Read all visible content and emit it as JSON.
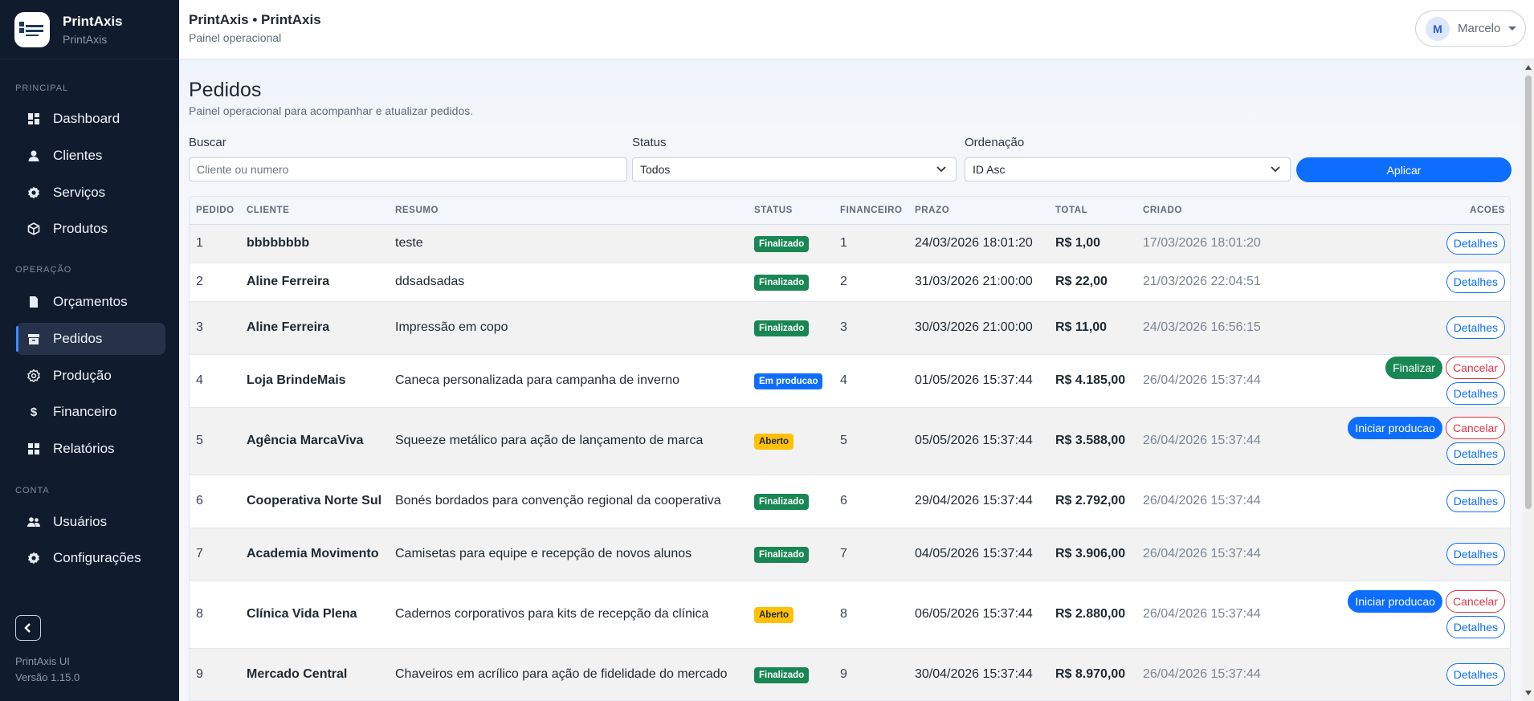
{
  "brand": {
    "name": "PrintAxis",
    "sub": "PrintAxis"
  },
  "nav": {
    "sections": {
      "principal": "PRINCIPAL",
      "operacao": "OPERAÇÃO",
      "conta": "CONTA"
    },
    "items": {
      "dashboard": "Dashboard",
      "clientes": "Clientes",
      "servicos": "Serviços",
      "produtos": "Produtos",
      "orcamentos": "Orçamentos",
      "pedidos": "Pedidos",
      "producao": "Produção",
      "financeiro": "Financeiro",
      "relatorios": "Relatórios",
      "usuarios": "Usuários",
      "configuracoes": "Configurações"
    },
    "active": "pedidos"
  },
  "sidebar_footer": {
    "app": "PrintAxis UI",
    "version": "Versão 1.15.0"
  },
  "header": {
    "title": "PrintAxis • PrintAxis",
    "subtitle": "Painel operacional",
    "user_initial": "M",
    "user_name": "Marcelo"
  },
  "page": {
    "title": "Pedidos",
    "subtitle": "Painel operacional para acompanhar e atualizar pedidos."
  },
  "filters": {
    "search_label": "Buscar",
    "search_placeholder": "Cliente ou numero",
    "status_label": "Status",
    "status_value": "Todos",
    "order_label": "Ordenação",
    "order_value": "ID Asc",
    "apply_label": "Aplicar"
  },
  "table": {
    "headers": {
      "pedido": "PEDIDO",
      "cliente": "CLIENTE",
      "resumo": "RESUMO",
      "status": "STATUS",
      "financeiro": "FINANCEIRO",
      "prazo": "PRAZO",
      "total": "TOTAL",
      "criado": "CRIADO",
      "acoes": "ACOES"
    },
    "action_labels": {
      "detalhes": "Detalhes",
      "finalizar": "Finalizar",
      "cancelar": "Cancelar",
      "iniciar": "Iniciar producao"
    },
    "rows": [
      {
        "id": "1",
        "cliente": "bbbbbbbb",
        "resumo": "teste",
        "status": "Finalizado",
        "status_kind": "done",
        "financeiro": "1",
        "prazo": "24/03/2026 18:01:20",
        "total": "R$ 1,00",
        "criado": "17/03/2026 18:01:20",
        "actions": [
          "detalhes"
        ]
      },
      {
        "id": "2",
        "cliente": "Aline Ferreira",
        "resumo": "ddsadsadas",
        "status": "Finalizado",
        "status_kind": "done",
        "financeiro": "2",
        "prazo": "31/03/2026 21:00:00",
        "total": "R$ 22,00",
        "criado": "21/03/2026 22:04:51",
        "actions": [
          "detalhes"
        ]
      },
      {
        "id": "3",
        "cliente": "Aline Ferreira",
        "resumo": "Impressão em copo",
        "status": "Finalizado",
        "status_kind": "done",
        "financeiro": "3",
        "prazo": "30/03/2026 21:00:00",
        "total": "R$ 11,00",
        "criado": "24/03/2026 16:56:15",
        "actions": [
          "detalhes"
        ]
      },
      {
        "id": "4",
        "cliente": "Loja BrindeMais",
        "resumo": "Caneca personalizada para campanha de inverno",
        "status": "Em producao",
        "status_kind": "prod",
        "financeiro": "4",
        "prazo": "01/05/2026 15:37:44",
        "total": "R$ 4.185,00",
        "criado": "26/04/2026 15:37:44",
        "actions": [
          "finalizar",
          "cancelar",
          "detalhes"
        ]
      },
      {
        "id": "5",
        "cliente": "Agência MarcaViva",
        "resumo": "Squeeze metálico para ação de lançamento de marca",
        "status": "Aberto",
        "status_kind": "open",
        "financeiro": "5",
        "prazo": "05/05/2026 15:37:44",
        "total": "R$ 3.588,00",
        "criado": "26/04/2026 15:37:44",
        "actions": [
          "iniciar",
          "cancelar",
          "detalhes"
        ]
      },
      {
        "id": "6",
        "cliente": "Cooperativa Norte Sul",
        "resumo": "Bonés bordados para convenção regional da cooperativa",
        "status": "Finalizado",
        "status_kind": "done",
        "financeiro": "6",
        "prazo": "29/04/2026 15:37:44",
        "total": "R$ 2.792,00",
        "criado": "26/04/2026 15:37:44",
        "actions": [
          "detalhes"
        ]
      },
      {
        "id": "7",
        "cliente": "Academia Movimento",
        "resumo": "Camisetas para equipe e recepção de novos alunos",
        "status": "Finalizado",
        "status_kind": "done",
        "financeiro": "7",
        "prazo": "04/05/2026 15:37:44",
        "total": "R$ 3.906,00",
        "criado": "26/04/2026 15:37:44",
        "actions": [
          "detalhes"
        ]
      },
      {
        "id": "8",
        "cliente": "Clínica Vida Plena",
        "resumo": "Cadernos corporativos para kits de recepção da clínica",
        "status": "Aberto",
        "status_kind": "open",
        "financeiro": "8",
        "prazo": "06/05/2026 15:37:44",
        "total": "R$ 2.880,00",
        "criado": "26/04/2026 15:37:44",
        "actions": [
          "iniciar",
          "cancelar",
          "detalhes"
        ]
      },
      {
        "id": "9",
        "cliente": "Mercado Central",
        "resumo": "Chaveiros em acrílico para ação de fidelidade do mercado",
        "status": "Finalizado",
        "status_kind": "done",
        "financeiro": "9",
        "prazo": "30/04/2026 15:37:44",
        "total": "R$ 8.970,00",
        "criado": "26/04/2026 15:37:44",
        "actions": [
          "detalhes"
        ]
      }
    ]
  },
  "colors": {
    "sidebar": "#101b2d",
    "primary": "#0d6efd",
    "success": "#198754",
    "warning": "#ffc107",
    "danger": "#dc3545"
  }
}
